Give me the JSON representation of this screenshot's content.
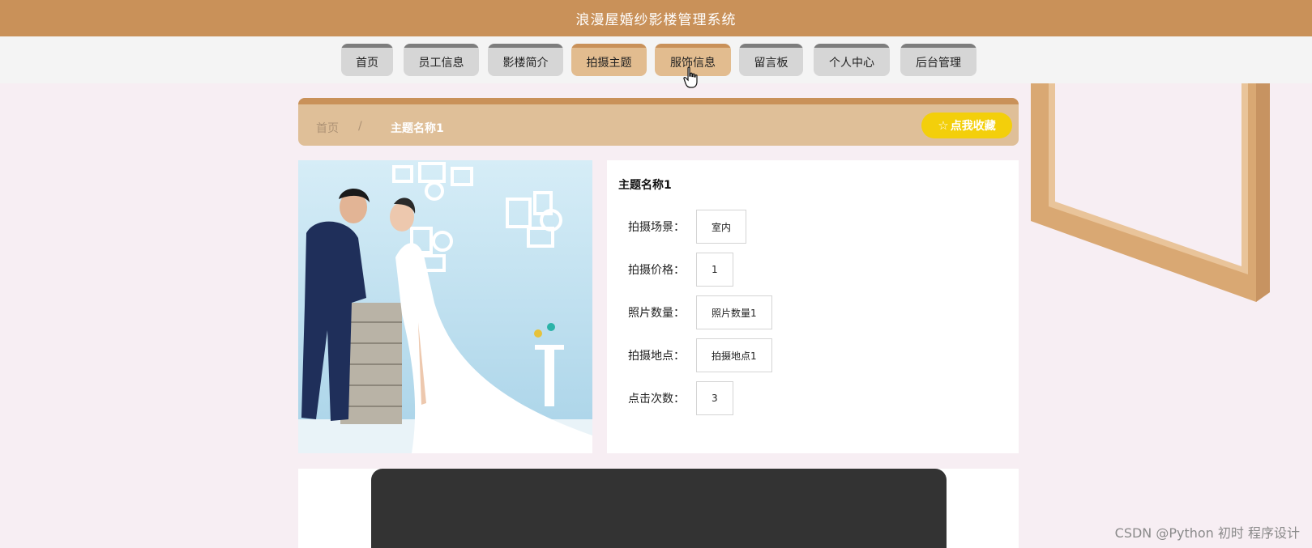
{
  "header": {
    "title": "浪漫屋婚纱影楼管理系统"
  },
  "nav": {
    "items": [
      {
        "label": "首页",
        "active": false
      },
      {
        "label": "员工信息",
        "active": false
      },
      {
        "label": "影楼简介",
        "active": false
      },
      {
        "label": "拍摄主题",
        "active": true
      },
      {
        "label": "服饰信息",
        "active": true
      },
      {
        "label": "留言板",
        "active": false
      },
      {
        "label": "个人中心",
        "active": false
      },
      {
        "label": "后台管理",
        "active": false
      }
    ]
  },
  "breadcrumb": {
    "home": "首页",
    "separator": "/",
    "current": "主题名称1"
  },
  "favorite": {
    "icon": "star-outline-icon",
    "label": "点我收藏"
  },
  "detail": {
    "title": "主题名称1",
    "fields": [
      {
        "label": "拍摄场景：",
        "value": "室内"
      },
      {
        "label": "拍摄价格：",
        "value": "1"
      },
      {
        "label": "照片数量：",
        "value": "照片数量1"
      },
      {
        "label": "拍摄地点：",
        "value": "拍摄地点1"
      },
      {
        "label": "点击次数：",
        "value": "3"
      }
    ]
  },
  "watermark": "CSDN @Python 初时 程序设计",
  "colors": {
    "header": "#c99159",
    "nav_active": "#e2bc8f",
    "nav_inactive": "#d6d6d6",
    "crumb_bar": "#dfbf98",
    "favorite_button": "#f3cf0b",
    "background": "#f7eef3",
    "video_box": "#333333"
  }
}
